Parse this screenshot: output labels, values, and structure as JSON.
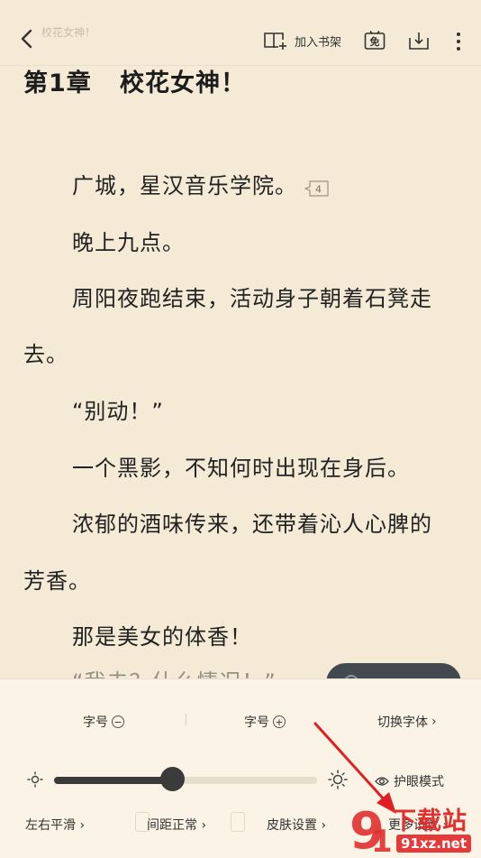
{
  "toolbar": {
    "ghost_title": "校花女神！",
    "add_shelf_label": "加入书架",
    "free_label": "免"
  },
  "chapter_title": "第1章   校花女神！",
  "paragraphs": [
    "广城，星汉音乐学院。",
    "晚上九点。",
    "周阳夜跑结束，活动身子朝着石凳走",
    "去。",
    "“别动！”",
    "一个黑影，不知何时出现在身后。",
    "浓郁的酒味传来，还带着沁人心脾的",
    "芳香。",
    "那是美女的体香！",
    "“我去？什么情况！”"
  ],
  "comment_badge": "4",
  "settings": {
    "font_size_minus_label": "字号",
    "font_size_plus_label": "字号",
    "switch_font_label": "切换字体",
    "eye_mode_label": "护眼模式",
    "page_turn_label": "左右平滑",
    "spacing_label": "间距正常",
    "skin_label": "皮肤设置",
    "more_label": "更多设置",
    "brightness": 0.45
  },
  "watermark": {
    "title": "下载站",
    "url": "91xz.net"
  },
  "colors": {
    "background": "#f4ead6",
    "panel": "#faf3e6",
    "arrow": "#e02020"
  }
}
